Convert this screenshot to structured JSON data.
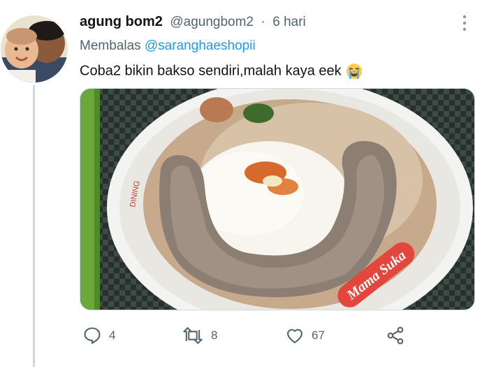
{
  "tweet": {
    "display_name": "agung bom2",
    "handle": "@agungbom2",
    "separator": "·",
    "time": "6 hari",
    "reply_prefix": "Membalas",
    "reply_mention": "@saranghaeshopii",
    "text": "Coba2 bikin bakso sendiri,malah kaya eek",
    "emoji": "loudly-crying-face",
    "media_bowl_text": "Mama Suka",
    "media_bowl_text_left": "DINING"
  },
  "actions": {
    "reply_count": "4",
    "retweet_count": "8",
    "like_count": "67"
  },
  "colors": {
    "link": "#1d9bf0",
    "secondary": "#536471",
    "primary": "#0f1419"
  }
}
